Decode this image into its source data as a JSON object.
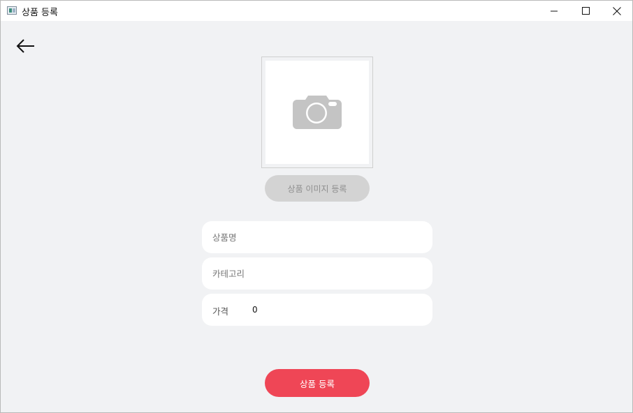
{
  "window": {
    "title": "상품 등록"
  },
  "image": {
    "icon": "camera-icon",
    "upload_button_label": "상품 이미지 등록"
  },
  "form": {
    "name_placeholder": "상품명",
    "category_placeholder": "카테고리",
    "price_label": "가격",
    "price_value": "0"
  },
  "submit": {
    "label": "상품 등록"
  },
  "colors": {
    "background": "#f1f2f4",
    "primary": "#ef4656",
    "disabled_button": "#d3d3d3",
    "camera_icon": "#c4c4c4"
  }
}
